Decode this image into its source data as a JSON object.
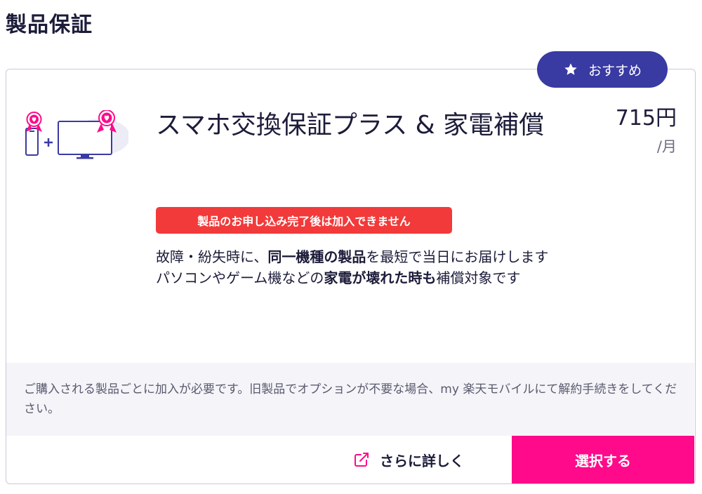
{
  "section": {
    "title": "製品保証"
  },
  "plan": {
    "badge_label": "おすすめ",
    "name": "スマホ交換保証プラス & 家電補償",
    "price": "715円",
    "price_unit": "/月",
    "notice": "製品のお申し込み完了後は加入できません",
    "description": [
      {
        "text": "故障・紛失時に、",
        "bold": false
      },
      {
        "text": "同一機種の製品",
        "bold": true
      },
      {
        "text": "を最短で当日にお届けします",
        "bold": false
      },
      {
        "text": "\n",
        "bold": false
      },
      {
        "text": "パソコンやゲーム機などの",
        "bold": false
      },
      {
        "text": "家電が壊れた時も",
        "bold": true
      },
      {
        "text": "補償対象です",
        "bold": false
      }
    ],
    "footnote": "ご購入される製品ごとに加入が必要です。旧製品でオプションが不要な場合、my 楽天モバイルにて解約手続きをしてください。",
    "more_label": "さらに詳しく",
    "select_label": "選択する"
  },
  "colors": {
    "badge": "#3a3aa3",
    "notice": "#f23a3a",
    "select_button": "#ff0a8a",
    "accent_pink": "#ff0a8a"
  },
  "icons": {
    "badge": "star-icon",
    "more_link": "external-link-icon",
    "illustration": "phone-plus-tv-illustration"
  }
}
